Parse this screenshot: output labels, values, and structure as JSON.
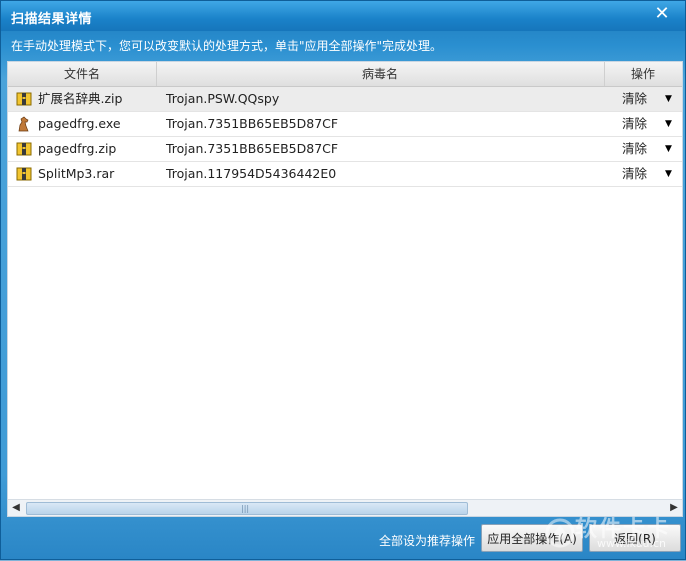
{
  "window": {
    "title": "扫描结果详情",
    "close_symbol": "✕"
  },
  "hint": "在手动处理模式下，您可以改变默认的处理方式，单击\"应用全部操作\"完成处理。",
  "table": {
    "columns": [
      "文件名",
      "病毒名",
      "操作"
    ],
    "rows": [
      {
        "file": "扩展名辞典.zip",
        "virus": "Trojan.PSW.QQspy",
        "action": "清除",
        "icon": "archive-icon"
      },
      {
        "file": "pagedfrg.exe",
        "virus": "Trojan.7351BB65EB5D87CF",
        "action": "清除",
        "icon": "exe-horse-icon"
      },
      {
        "file": "pagedfrg.zip",
        "virus": "Trojan.7351BB65EB5D87CF",
        "action": "清除",
        "icon": "archive-icon"
      },
      {
        "file": "SplitMp3.rar",
        "virus": "Trojan.117954D5436442E0",
        "action": "清除",
        "icon": "archive-icon"
      }
    ],
    "dropdown_symbol": "▼"
  },
  "scrollbar": {
    "left": "◀",
    "right": "▶",
    "grip": "|||"
  },
  "footer": {
    "label": "全部设为推荐操作",
    "apply_button": "应用全部操作(A)",
    "back_button": "返回(R)"
  },
  "watermark": {
    "brand": "软件卡卡",
    "url": "www.ikuu.cn"
  }
}
